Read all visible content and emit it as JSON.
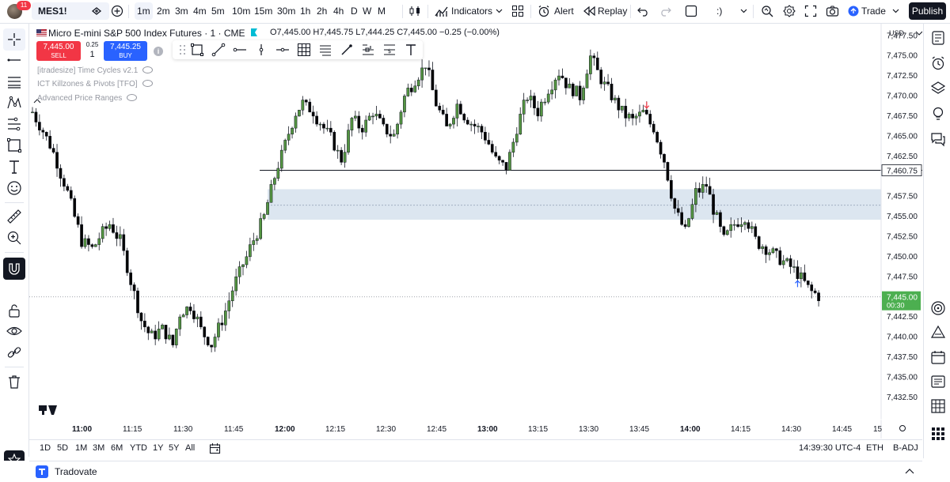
{
  "topbar": {
    "notification_count": "11",
    "symbol": "MES1!",
    "intervals": [
      "1m",
      "2m",
      "3m",
      "4m",
      "5m",
      "10m",
      "15m",
      "30m",
      "1h",
      "2h",
      "4h",
      "D",
      "W",
      "M"
    ],
    "active_interval": "1m",
    "indicators_label": "Indicators",
    "alert_label": "Alert",
    "replay_label": "Replay",
    "emoji_label": ":)",
    "trade_label": "Trade",
    "publish_label": "Publish"
  },
  "legend": {
    "title": "Micro E-mini S&P 500 Index Futures · 1 · CME",
    "ohlc": "O7,445.00 H7,445.75 L7,444.25 C7,445.00 −0.25 (−0.00%)"
  },
  "order_panel": {
    "sell_price": "7,445.00",
    "sell_label": "SELL",
    "spread": "0.25",
    "quantity": "1",
    "buy_price": "7,445.25",
    "buy_label": "BUY"
  },
  "indicators": [
    "[itradesize] Time Cycles v2.1",
    "ICT Killzones & Pivots [TFO]",
    "Advanced Price Ranges"
  ],
  "price_axis": {
    "currency": "USD",
    "ticks": [
      "7,477.50",
      "7,475.00",
      "7,472.50",
      "7,470.00",
      "7,467.50",
      "7,465.00",
      "7,462.50",
      "7,457.50",
      "7,455.00",
      "7,452.50",
      "7,450.00",
      "7,447.50",
      "7,442.50",
      "7,440.00",
      "7,437.50",
      "7,435.00",
      "7,432.50"
    ],
    "hline_label": "7,460.75",
    "last_price_label": "7,445.00",
    "countdown": "00:30"
  },
  "time_axis": {
    "ticks": [
      "11:00",
      "11:15",
      "11:30",
      "11:45",
      "12:00",
      "12:15",
      "12:30",
      "12:45",
      "13:00",
      "13:15",
      "13:30",
      "13:45",
      "14:00",
      "14:15",
      "14:30",
      "14:45",
      "15"
    ],
    "bold_ticks": [
      "11:00",
      "12:00",
      "13:00",
      "14:00"
    ]
  },
  "range_bar": {
    "ranges": [
      "1D",
      "5D",
      "1M",
      "3M",
      "6M",
      "YTD",
      "1Y",
      "5Y",
      "All"
    ],
    "clock": "14:39:30 UTC-4",
    "session": "ETH",
    "adjust": "B-ADJ"
  },
  "footer": {
    "broker": "Tradovate"
  },
  "colors": {
    "up": "#549542",
    "down": "#000000",
    "sell": "#f23645",
    "buy": "#2962ff",
    "last_price": "#4caf50",
    "zone": "#dce6f0",
    "publish": "#131722"
  },
  "chart_data": {
    "type": "candlestick",
    "symbol": "MES1!",
    "interval": "1m",
    "y_range": [
      7431,
      7479
    ],
    "x_range": [
      "10:53",
      "14:53"
    ],
    "horizontal_line": 7460.75,
    "zone": {
      "from": 7454.6,
      "to": 7458.4,
      "start": "12:00",
      "mid": 7456.4
    },
    "last_price": 7445.0,
    "markers": [
      {
        "type": "sell-arrow",
        "time": "13:48",
        "price": 7468.5
      },
      {
        "type": "buy-arrow",
        "time": "14:31",
        "price": 7447.0
      }
    ],
    "close_path": [
      [
        "10:53",
        7468
      ],
      [
        "10:58",
        7464
      ],
      [
        "11:03",
        7458
      ],
      [
        "11:07",
        7452
      ],
      [
        "11:10",
        7451
      ],
      [
        "11:13",
        7453
      ],
      [
        "11:15",
        7454
      ],
      [
        "11:18",
        7452
      ],
      [
        "11:21",
        7447
      ],
      [
        "11:24",
        7442
      ],
      [
        "11:27",
        7440
      ],
      [
        "11:30",
        7441
      ],
      [
        "11:33",
        7439
      ],
      [
        "11:35",
        7443
      ],
      [
        "11:38",
        7444
      ],
      [
        "11:41",
        7441
      ],
      [
        "11:44",
        7439
      ],
      [
        "11:47",
        7442
      ],
      [
        "11:50",
        7446
      ],
      [
        "11:53",
        7449
      ],
      [
        "11:56",
        7452
      ],
      [
        "11:59",
        7455
      ],
      [
        "12:02",
        7460
      ],
      [
        "12:05",
        7464
      ],
      [
        "12:08",
        7468
      ],
      [
        "12:10",
        7469
      ],
      [
        "12:13",
        7468
      ],
      [
        "12:16",
        7466
      ],
      [
        "12:19",
        7464
      ],
      [
        "12:21",
        7462
      ],
      [
        "12:24",
        7467
      ],
      [
        "12:27",
        7466
      ],
      [
        "12:30",
        7468
      ],
      [
        "12:33",
        7466
      ],
      [
        "12:36",
        7465
      ],
      [
        "12:39",
        7470
      ],
      [
        "12:42",
        7472
      ],
      [
        "12:45",
        7474
      ],
      [
        "12:48",
        7469
      ],
      [
        "12:51",
        7466
      ],
      [
        "12:54",
        7469
      ],
      [
        "12:57",
        7467
      ],
      [
        "13:00",
        7466
      ],
      [
        "13:02",
        7465
      ],
      [
        "13:05",
        7462
      ],
      [
        "13:08",
        7461
      ],
      [
        "13:11",
        7466
      ],
      [
        "13:14",
        7470
      ],
      [
        "13:17",
        7468
      ],
      [
        "13:20",
        7471
      ],
      [
        "13:23",
        7473
      ],
      [
        "13:26",
        7471
      ],
      [
        "13:29",
        7470
      ],
      [
        "13:32",
        7475
      ],
      [
        "13:35",
        7472
      ],
      [
        "13:38",
        7470
      ],
      [
        "13:41",
        7468
      ],
      [
        "13:44",
        7467
      ],
      [
        "13:47",
        7468
      ],
      [
        "13:50",
        7466
      ],
      [
        "13:53",
        7462
      ],
      [
        "13:56",
        7456
      ],
      [
        "13:59",
        7453
      ],
      [
        "14:02",
        7458
      ],
      [
        "14:05",
        7459
      ],
      [
        "14:07",
        7456
      ],
      [
        "14:10",
        7452
      ],
      [
        "14:13",
        7454
      ],
      [
        "14:16",
        7455
      ],
      [
        "14:19",
        7452
      ],
      [
        "14:22",
        7451
      ],
      [
        "14:25",
        7450
      ],
      [
        "14:28",
        7449
      ],
      [
        "14:31",
        7448
      ],
      [
        "14:34",
        7446
      ],
      [
        "14:37",
        7445
      ]
    ]
  }
}
